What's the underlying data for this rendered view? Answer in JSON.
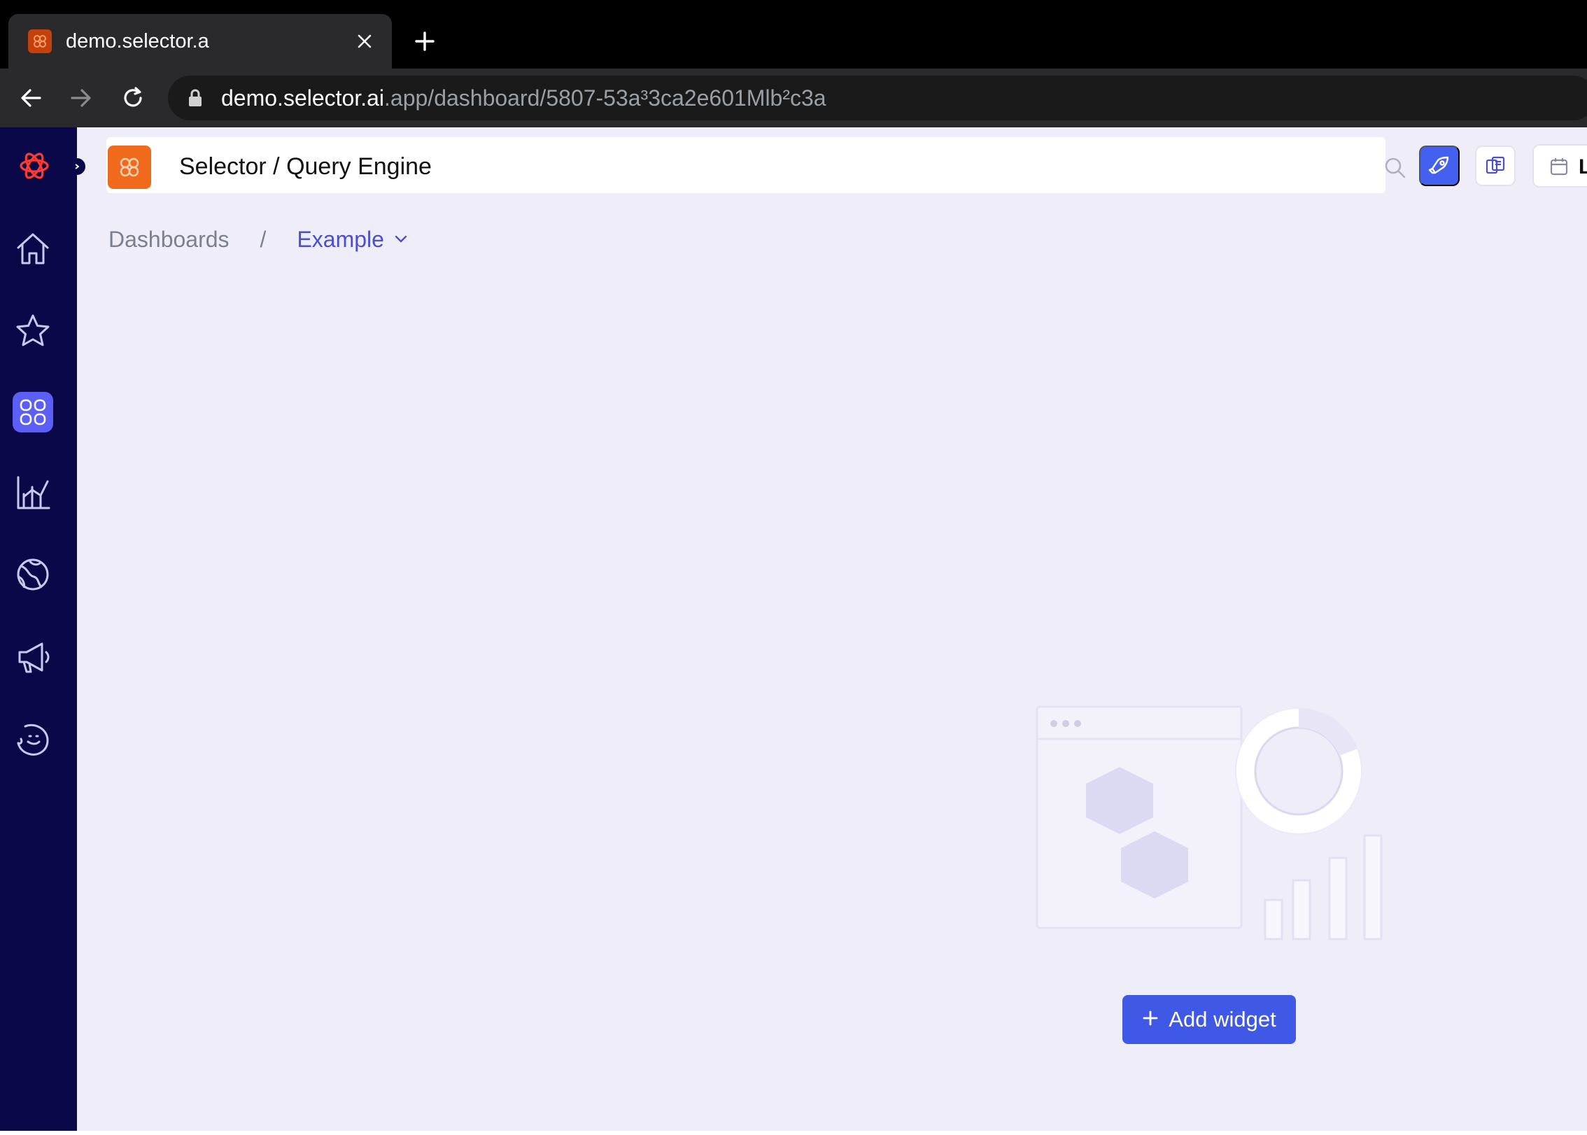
{
  "browser": {
    "tab_title": "demo.selector.a",
    "url_host": "demo.selector.ai",
    "url_path": ".app/dashboard/5807-53a³3ca2e601Mlb²c3a"
  },
  "header": {
    "title": "Selector / Query Engine",
    "date_label": "L"
  },
  "sidebar": {
    "items": [
      {
        "icon": "home-icon"
      },
      {
        "icon": "star-icon"
      },
      {
        "icon": "dashboard-icon",
        "active": true
      },
      {
        "icon": "analytics-icon"
      },
      {
        "icon": "globe-icon"
      },
      {
        "icon": "megaphone-icon"
      },
      {
        "icon": "assistant-icon"
      }
    ]
  },
  "breadcrumb": {
    "root": "Dashboards",
    "separator": "/",
    "current": "Example"
  },
  "empty_state": {
    "add_widget_label": "Add widget"
  },
  "colors": {
    "sidebar_bg": "#0a0848",
    "accent": "#3f59e6",
    "brand_orange": "#f06a1c",
    "canvas_bg": "#efeef8"
  }
}
